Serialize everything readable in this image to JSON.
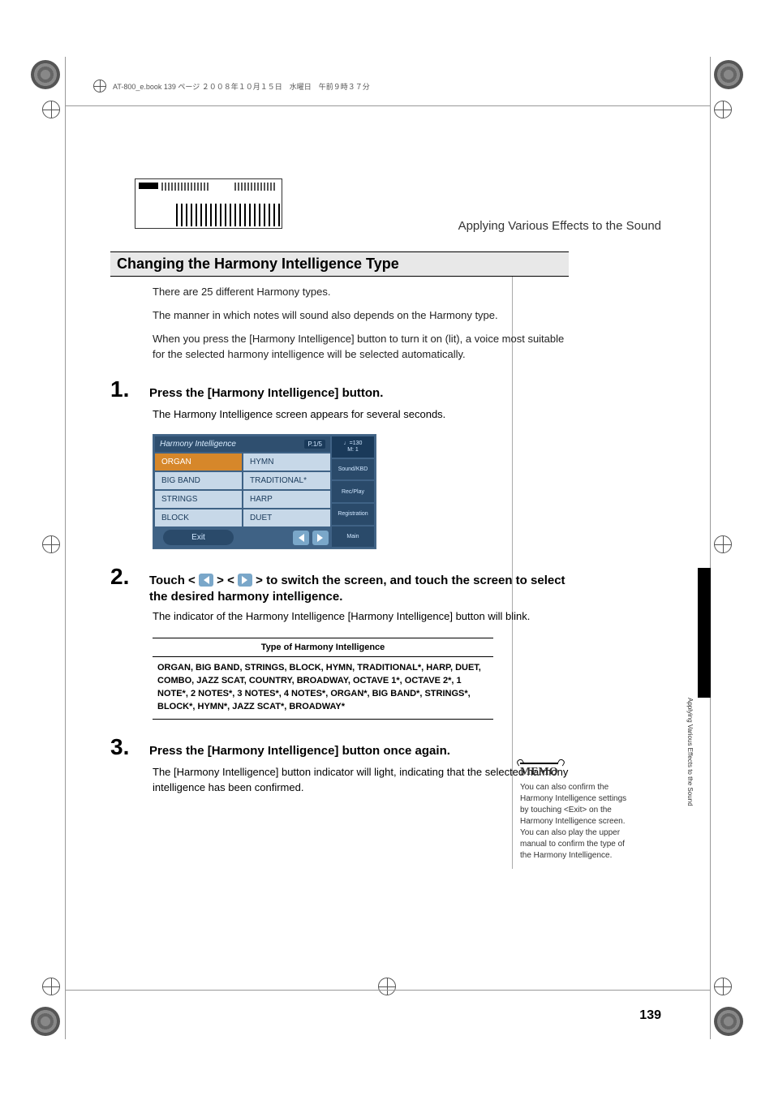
{
  "header_line": "AT-800_e.book  139 ページ  ２００８年１０月１５日　水曜日　午前９時３７分",
  "chapter_title": "Applying Various Effects to the Sound",
  "section_heading": "Changing the Harmony Intelligence Type",
  "intro": {
    "p1": "There are 25 different Harmony types.",
    "p2": "The manner in which notes will sound also depends on the Harmony type.",
    "p3": "When you press the [Harmony Intelligence] button to turn it on (lit), a voice most suitable for the selected harmony intelligence will be selected automatically."
  },
  "steps": {
    "s1": {
      "num": "1.",
      "head": "Press the [Harmony Intelligence] button.",
      "body": "The Harmony Intelligence screen appears for several seconds."
    },
    "s2": {
      "num": "2.",
      "head_prefix": "Touch < ",
      "head_mid": " > < ",
      "head_suffix": " > to switch the screen, and touch the screen to select the desired harmony intelligence.",
      "body": "The indicator of the Harmony Intelligence [Harmony Intelligence] button will blink."
    },
    "s3": {
      "num": "3.",
      "head": "Press the [Harmony Intelligence] button once again.",
      "body": "The [Harmony Intelligence] button indicator will light, indicating that the selected harmony intelligence has been confirmed."
    }
  },
  "hi_screen": {
    "title": "Harmony Intelligence",
    "page_indicator": "P.1/5",
    "tempo": "♩=130\nM:   1",
    "side": {
      "sound": "Sound/KBD",
      "recplay": "Rec/Play",
      "registration": "Registration",
      "main": "Main"
    },
    "cells": {
      "organ": "ORGAN",
      "hymn": "HYMN",
      "bigband": "BIG BAND",
      "traditional": "TRADITIONAL*",
      "strings": "STRINGS",
      "harp": "HARP",
      "block": "BLOCK",
      "duet": "DUET"
    },
    "exit": "Exit"
  },
  "type_table": {
    "header": "Type of Harmony Intelligence",
    "body": "ORGAN, BIG BAND, STRINGS, BLOCK, HYMN, TRADITIONAL*, HARP, DUET, COMBO, JAZZ SCAT, COUNTRY, BROADWAY, OCTAVE 1*, OCTAVE 2*, 1 NOTE*, 2 NOTES*, 3 NOTES*, 4 NOTES*, ORGAN*, BIG BAND*, STRINGS*, BLOCK*, HYMN*, JAZZ SCAT*, BROADWAY*"
  },
  "memo": {
    "label": "MEMO",
    "text": "You can also confirm the Harmony Intelligence settings by touching <Exit> on the Harmony Intelligence screen. You can also play the upper manual to confirm the type of the Harmony Intelligence."
  },
  "side_tab_text": "Applying Various Effects to the Sound",
  "page_number": "139"
}
